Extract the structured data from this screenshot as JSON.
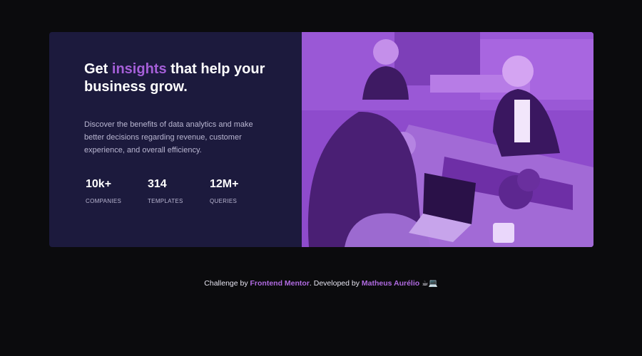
{
  "hero": {
    "title_prefix": "Get ",
    "title_accent": "insights",
    "title_suffix": " that help your business grow.",
    "description": "Discover the benefits of data analytics and make better decisions regarding revenue, customer experience, and overall efficiency.",
    "stats": [
      {
        "value": "10k+",
        "label": "COMPANIES"
      },
      {
        "value": "314",
        "label": "TEMPLATES"
      },
      {
        "value": "12M+",
        "label": "QUERIES"
      }
    ],
    "photo_alt": "people-working-icon"
  },
  "footer": {
    "prefix": "Challenge by ",
    "challenge_link": "Frontend Mentor",
    "middle": ". Developed by ",
    "author_link": "Matheus Aurélio",
    "emoji": "☕💻"
  },
  "colors": {
    "page_bg": "#0b0b0d",
    "card_bg": "#1c1a3d",
    "accent": "#a55fd8",
    "photo_tint": "#8b49c9"
  }
}
